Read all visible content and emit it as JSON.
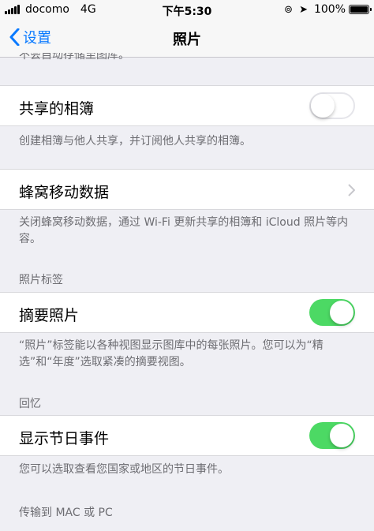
{
  "status_bar": {
    "carrier": "docomo",
    "network": "4G",
    "time": "下午5:30",
    "battery": "100%"
  },
  "nav": {
    "back_label": "设置",
    "title": "照片"
  },
  "sections": {
    "cut_footer": "不会自动存储至图库。",
    "shared_albums": {
      "label": "共享的相簿",
      "toggle": "off",
      "footer": "创建相簿与他人共享，并订阅他人共享的相簿。"
    },
    "cellular": {
      "label": "蜂窝移动数据",
      "footer": "关闭蜂窝移动数据，通过 Wi-Fi 更新共享的相簿和 iCloud 照片等内容。"
    },
    "photos_tab": {
      "header": "照片标签",
      "label": "摘要照片",
      "toggle": "on",
      "footer": "“照片”标签能以各种视图显示图库中的每张照片。您可以为“精选”和“年度”选取紧凑的摘要视图。"
    },
    "memories": {
      "header": "回忆",
      "label": "显示节日事件",
      "toggle": "on",
      "footer": "您可以选取查看您国家或地区的节日事件。"
    },
    "transfer": {
      "header": "传输到 MAC 或 PC"
    }
  },
  "colors": {
    "accent": "#0a7aff",
    "toggle_on": "#4cd964",
    "background": "#efeff4"
  }
}
